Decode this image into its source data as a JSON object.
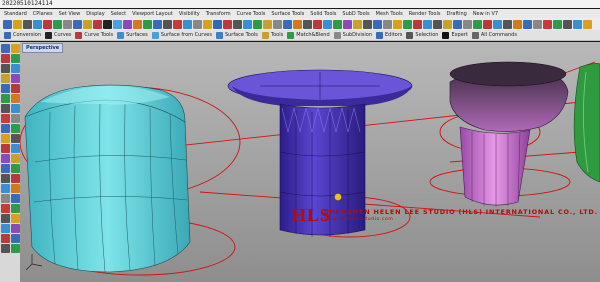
{
  "recording": {
    "timestamp": "20220510124114"
  },
  "menu": {
    "tabs": [
      "Standard",
      "CPlanes",
      "Set View",
      "Display",
      "Select",
      "Viewport Layout",
      "Visibility",
      "Transform",
      "Curve Tools",
      "Surface Tools",
      "Solid Tools",
      "SubD Tools",
      "Mesh Tools",
      "Render Tools",
      "Drafting",
      "New in V7"
    ]
  },
  "toolbar": {
    "items": [
      {
        "label": "Conversion",
        "icon": "conversion-icon",
        "color": "#3a6bb8"
      },
      {
        "label": "Curves",
        "icon": "curve-icon",
        "color": "#222222"
      },
      {
        "label": "Curve Tools",
        "icon": "curve-tools-icon",
        "color": "#b83a3a"
      },
      {
        "label": "Surfaces",
        "icon": "surface-icon",
        "color": "#3a8fd0"
      },
      {
        "label": "Surface from Curves",
        "icon": "surface-from-curves-icon",
        "color": "#4aa0d8"
      },
      {
        "label": "Surface Tools",
        "icon": "surface-tools-icon",
        "color": "#3a7fc8"
      },
      {
        "label": "Tools",
        "icon": "tools-icon",
        "color": "#c8a030"
      },
      {
        "label": "Match&Blend",
        "icon": "match-blend-icon",
        "color": "#2f9a4a"
      },
      {
        "label": "SubDivision",
        "icon": "subdivision-icon",
        "color": "#8a8a8a"
      },
      {
        "label": "Editors",
        "icon": "editors-icon",
        "color": "#3a6bb8"
      },
      {
        "label": "Selection",
        "icon": "selection-icon",
        "color": "#555555"
      },
      {
        "label": "Expert",
        "icon": "expert-icon",
        "color": "#111111"
      },
      {
        "label": "All Commands",
        "icon": "all-commands-icon",
        "color": "#666666"
      }
    ]
  },
  "viewport": {
    "title": "Perspective"
  },
  "watermark": {
    "logo": "HLS",
    "studio": "SHENZHEN HELEN LEE STUDIO (HLS) INTERNATIONAL CO., LTD.",
    "subline": "www.helenleestudio.com"
  },
  "colors": {
    "teal_object": "#5fd3dc",
    "purple_object": "#4a35b8",
    "pink_object": "#d07ad8",
    "green_object": "#3aa84a",
    "curve_red": "#d41010"
  }
}
